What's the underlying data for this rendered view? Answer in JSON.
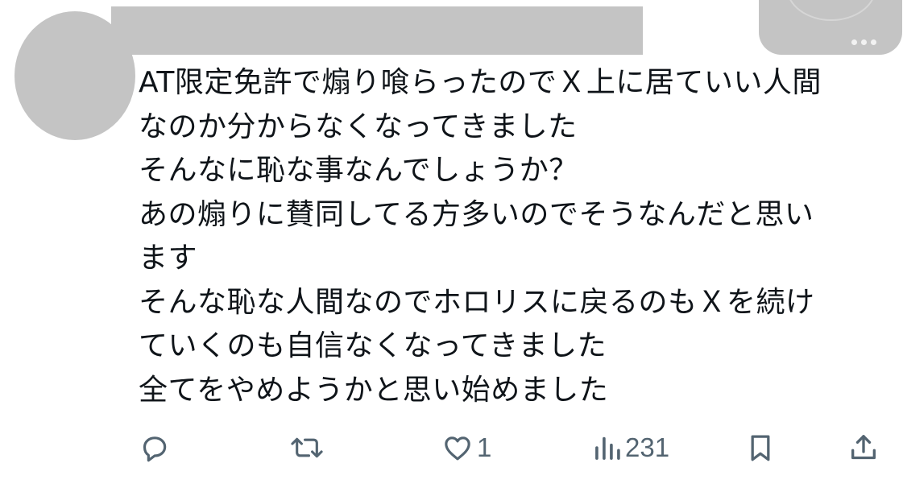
{
  "tweet": {
    "lines": [
      "AT限定免許で煽り喰らったのでＸ上に居ていい人間",
      "なのか分からなくなってきました",
      "そんなに恥な事なんでしょうか？",
      "あの煽りに賛同してる方多いのでそうなんだと思い",
      "ます",
      "そんな恥な人間なのでホロリスに戻るのもＸを続け",
      "ていくのも自信なくなってきました",
      "全てをやめようかと思い始めました"
    ]
  },
  "actions": {
    "reply": {
      "icon": "reply-icon",
      "count": ""
    },
    "repost": {
      "icon": "repost-icon",
      "count": ""
    },
    "like": {
      "icon": "heart-icon",
      "count": "1"
    },
    "views": {
      "icon": "views-icon",
      "count": "231"
    },
    "bookmark": {
      "icon": "bookmark-icon"
    },
    "share": {
      "icon": "share-icon"
    }
  },
  "colors": {
    "text": "#0f1419",
    "icon": "#536471",
    "redaction": "#c4c4c4"
  }
}
